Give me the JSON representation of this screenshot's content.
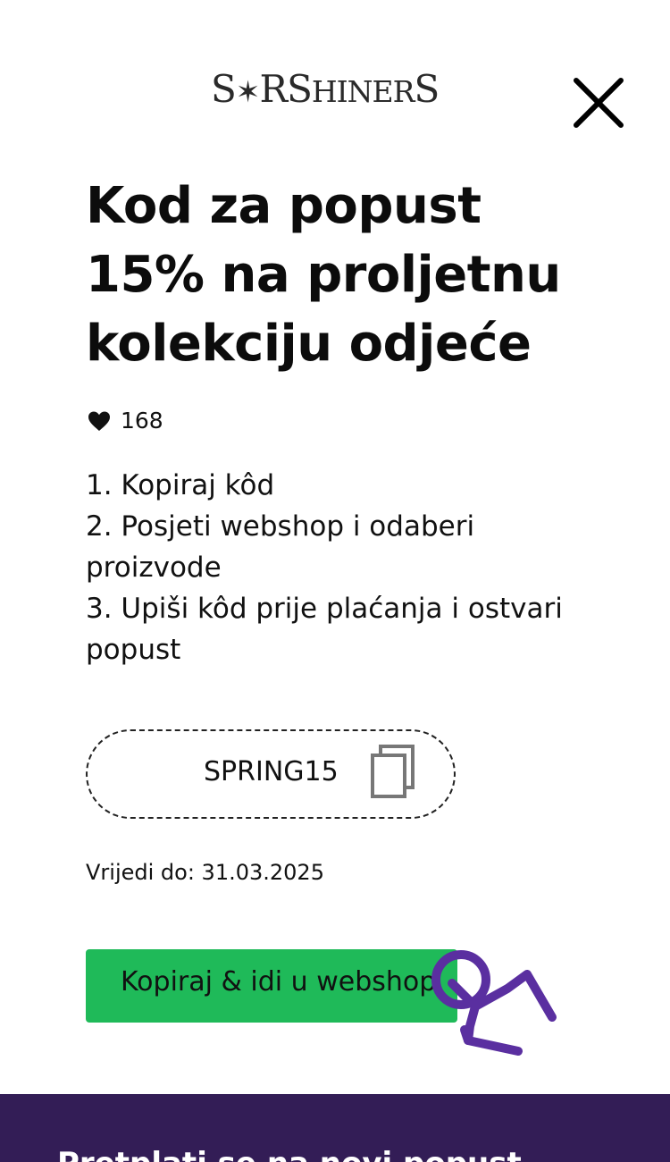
{
  "header": {
    "logo_text": "STARSHINERS",
    "close_label": "Close"
  },
  "offer": {
    "title_lines": [
      "Kod za popust",
      "15% na proljetnu",
      "kolekciju odjeće"
    ],
    "likes": "168",
    "steps": [
      "1. Kopiraj kôd",
      "2. Posjeti webshop i odaberi proizvode",
      "3. Upiši kôd prije plaćanja i ostvari popust"
    ],
    "code": "SPRING15",
    "valid_until": "Vrijedi do: 31.03.2025",
    "cta_label": "Kopiraj & idi u webshop"
  },
  "footer": {
    "text": "Pretplati se na novi popust"
  },
  "colors": {
    "cta_bg": "#1fba59",
    "footer_bg": "#331d56",
    "hand_icon": "#5a2fa0"
  },
  "icons": [
    "close-icon",
    "heart-icon",
    "copy-icon",
    "tap-hand-icon"
  ]
}
